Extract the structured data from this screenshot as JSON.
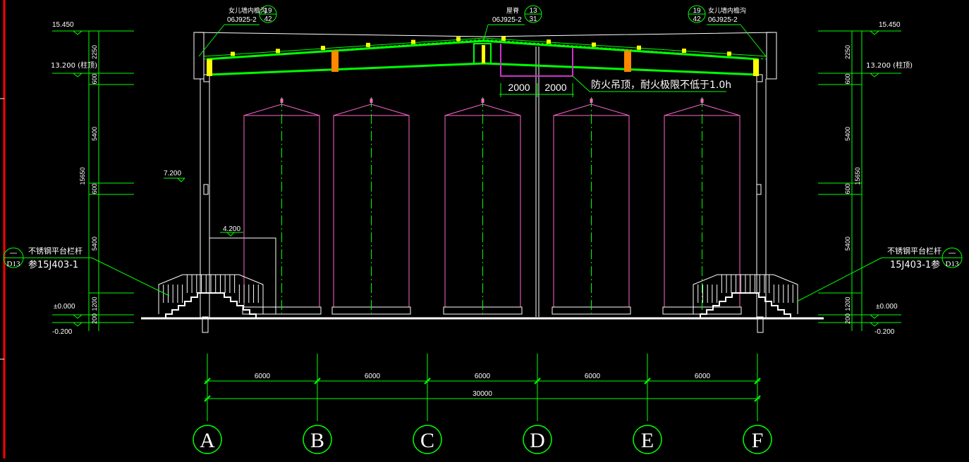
{
  "colors": {
    "background": "#000000",
    "structure": "#ffffff",
    "dimension": "#00ff00",
    "roof": "#00ff00",
    "tank": "#ff66cc",
    "ceiling": "#cc33cc",
    "accent_yellow": "#ffff00",
    "accent_orange": "#ff8800",
    "left_border": "#ff0000"
  },
  "elevations": {
    "top": "15.450",
    "column_top": "13.200 (柱顶)",
    "mid": "7.200",
    "platform": "4.200",
    "ground": "±0.000",
    "outdoor": "-0.200"
  },
  "vertical_dims": {
    "total": "15650",
    "parts": [
      "2250",
      "600",
      "5400",
      "600",
      "5400",
      "1200",
      "200"
    ]
  },
  "callouts": {
    "gutter_left": {
      "title": "女儿墙内檐沟",
      "code": "06J925-2",
      "num_top": "19",
      "num_bottom": "42"
    },
    "ridge": {
      "title": "屋脊",
      "code": "06J925-2",
      "num_top": "13",
      "num_bottom": "31"
    },
    "gutter_right": {
      "title": "女儿墙内檐沟",
      "code": "06J925-2",
      "num_top": "19",
      "num_bottom": "42"
    },
    "fire_ceiling": "防火吊顶，耐火极限不低于1.0h",
    "ceiling_dims": [
      "2000",
      "2000"
    ],
    "railing_left": {
      "title": "不锈钢平台栏杆",
      "ref": "参15J403-1",
      "num_top": "—",
      "num_bottom": "D13"
    },
    "railing_right": {
      "title": "不锈钢平台栏杆",
      "ref": "15J403-1参",
      "num_top": "—",
      "num_bottom": "D13"
    }
  },
  "horizontal_dims": {
    "spans": [
      "6000",
      "6000",
      "6000",
      "6000",
      "6000"
    ],
    "total": "30000"
  },
  "axes": [
    "A",
    "B",
    "C",
    "D",
    "E",
    "F"
  ]
}
